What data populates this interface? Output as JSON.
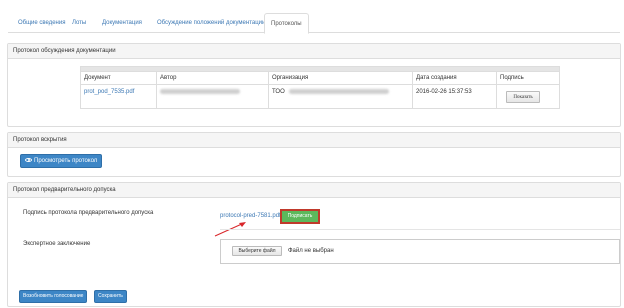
{
  "tabs": [
    {
      "label": "Общие сведения"
    },
    {
      "label": "Лоты"
    },
    {
      "label": "Документация"
    },
    {
      "label": "Обсуждение положений документации"
    },
    {
      "label": "Протоколы"
    }
  ],
  "discussion_panel": {
    "title": "Протокол обсуждения документации",
    "columns": [
      "Документ",
      "Автор",
      "Организация",
      "Дата создания",
      "Подпись"
    ],
    "row": {
      "document": "prot_pod_7535.pdf",
      "author": "",
      "organization": "ТОО",
      "date": "2016-02-26 15:37:53",
      "sign_button": "Показать"
    }
  },
  "opening_panel": {
    "title": "Протокол вскрытия",
    "view_button": "Просмотреть протокол"
  },
  "preliminary_panel": {
    "title": "Протокол предварительного допуска",
    "sign_label": "Подпись протокола предварительного допуска",
    "file_link": "protocol-pred-7581.pdf",
    "sign_button": "Подписать",
    "expert_label": "Экспертное заключение",
    "choose_file_button": "Выберите файл",
    "no_file_text": "Файл не выбран"
  },
  "footer": {
    "resume_button": "Возобновить голосование",
    "save_button": "Сохранить"
  },
  "colors": {
    "link": "#3c78b4",
    "primary": "#3d86c6",
    "success": "#5cb85c",
    "highlight": "#c0392b"
  }
}
